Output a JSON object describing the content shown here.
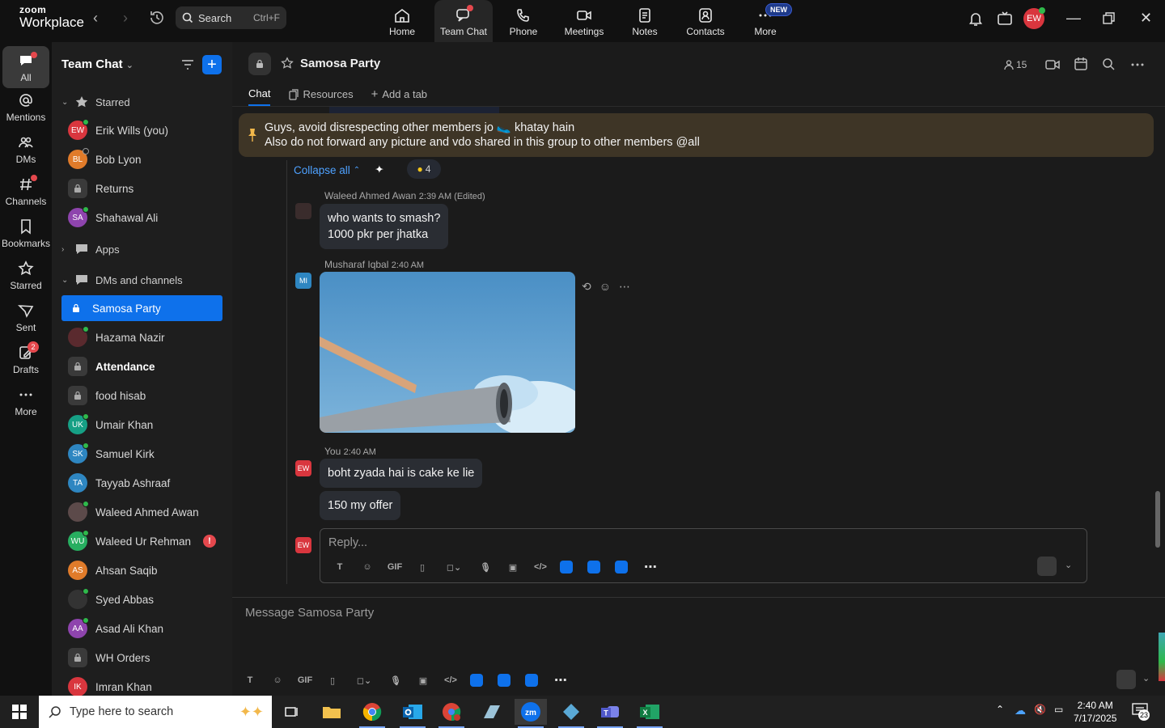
{
  "app": {
    "brand_top": "zoom",
    "brand_bottom": "Workplace"
  },
  "topbar": {
    "search_label": "Search",
    "search_shortcut": "Ctrl+F",
    "tabs": [
      {
        "label": "Home",
        "icon": "home-icon"
      },
      {
        "label": "Team Chat",
        "icon": "team-chat-icon"
      },
      {
        "label": "Phone",
        "icon": "phone-icon"
      },
      {
        "label": "Meetings",
        "icon": "video-icon"
      },
      {
        "label": "Notes",
        "icon": "notes-icon"
      },
      {
        "label": "Contacts",
        "icon": "contacts-icon"
      },
      {
        "label": "More",
        "icon": "more-icon"
      }
    ],
    "new_badge": "NEW",
    "user_initials": "EW"
  },
  "rail": {
    "items": [
      {
        "label": "All"
      },
      {
        "label": "Mentions"
      },
      {
        "label": "DMs"
      },
      {
        "label": "Channels"
      },
      {
        "label": "Bookmarks"
      },
      {
        "label": "Starred"
      },
      {
        "label": "Sent"
      },
      {
        "label": "Drafts",
        "badge": "2"
      },
      {
        "label": "More"
      }
    ]
  },
  "sidebar": {
    "title": "Team Chat",
    "sections": {
      "starred": "Starred",
      "apps": "Apps",
      "dms": "DMs and channels"
    },
    "starred": [
      {
        "initials": "EW",
        "name": "Erik Wills (you)",
        "color": "#d9363e"
      },
      {
        "initials": "BL",
        "name": "Bob Lyon",
        "color": "#e07b2a"
      },
      {
        "initials": "",
        "name": "Returns",
        "color": "#3a3a3a"
      },
      {
        "initials": "SA",
        "name": "Shahawal Ali",
        "color": "#8e44ad"
      }
    ],
    "channels": [
      {
        "initials": "",
        "name": "Samosa Party"
      },
      {
        "initials": "",
        "name": "Hazama Nazir"
      },
      {
        "initials": "",
        "name": "Attendance"
      },
      {
        "initials": "",
        "name": "food hisab"
      },
      {
        "initials": "UK",
        "name": "Umair Khan"
      },
      {
        "initials": "SK",
        "name": "Samuel Kirk"
      },
      {
        "initials": "TA",
        "name": "Tayyab Ashraaf"
      },
      {
        "initials": "",
        "name": "Waleed Ahmed Awan"
      },
      {
        "initials": "WU",
        "name": "Waleed Ur Rehman",
        "alert": "!"
      },
      {
        "initials": "AS",
        "name": "Ahsan Saqib"
      },
      {
        "initials": "",
        "name": "Syed Abbas"
      },
      {
        "initials": "AA",
        "name": "Asad Ali Khan"
      },
      {
        "initials": "",
        "name": "WH Orders"
      },
      {
        "initials": "IK",
        "name": "Imran Khan"
      }
    ]
  },
  "channel": {
    "name": "Samosa Party",
    "member_count": "15",
    "tabs": [
      "Chat",
      "Resources",
      "Add a tab"
    ],
    "pinned_line1": "Guys, avoid disrespecting other members jo 🥿 khatay hain",
    "pinned_line2": "Also do not forward any picture and vdo shared in this group to other members @all",
    "collapse_label": "Collapse all",
    "reaction_count": "4",
    "messages": [
      {
        "sender": "Waleed Ahmed Awan",
        "time": "2:39 AM (Edited)",
        "line1": "who wants to smash?",
        "line2": "1000 pkr per jhatka"
      },
      {
        "sender": "Musharaf Iqbal",
        "time": "2:40 AM",
        "initials": "MI"
      },
      {
        "sender": "You",
        "time": "2:40 AM",
        "initials": "EW",
        "bubble1": "boht zyada hai is cake ke lie",
        "bubble2": "150 my offer"
      }
    ],
    "reply_placeholder": "Reply...",
    "compose_placeholder": "Message Samosa Party",
    "gif_label": "GIF"
  },
  "taskbar": {
    "search_placeholder": "Type here to search",
    "time": "2:40 AM",
    "date": "7/17/2025",
    "notif_count": "23"
  }
}
